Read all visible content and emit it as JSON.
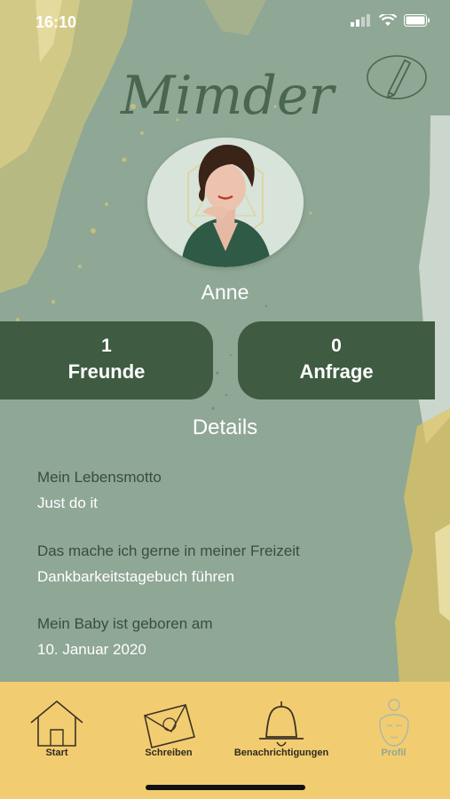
{
  "status_bar": {
    "time": "16:10"
  },
  "app": {
    "logo_text": "Mimder"
  },
  "profile": {
    "name": "Anne",
    "friends": {
      "count": "1",
      "label": "Freunde"
    },
    "requests": {
      "count": "0",
      "label": "Anfrage"
    }
  },
  "details": {
    "title": "Details",
    "items": [
      {
        "question": "Mein Lebensmotto",
        "answer": "Just do it"
      },
      {
        "question": "Das mache ich gerne in meiner Freizeit",
        "answer": "Dankbarkeitstagebuch führen"
      },
      {
        "question": "Mein Baby ist geboren am",
        "answer": "10. Januar 2020"
      }
    ]
  },
  "tabs": [
    {
      "label": "Start",
      "icon": "house-icon"
    },
    {
      "label": "Schreiben",
      "icon": "envelope-icon"
    },
    {
      "label": "Benachrichtigungen",
      "icon": "bell-icon"
    },
    {
      "label": "Profil",
      "icon": "profile-face-icon",
      "active": true
    }
  ],
  "colors": {
    "background": "#8fa795",
    "card": "#3f5b42",
    "tab_bar": "#f2cc70",
    "accent_gold": "#e8c766",
    "logo": "#4a6650"
  }
}
